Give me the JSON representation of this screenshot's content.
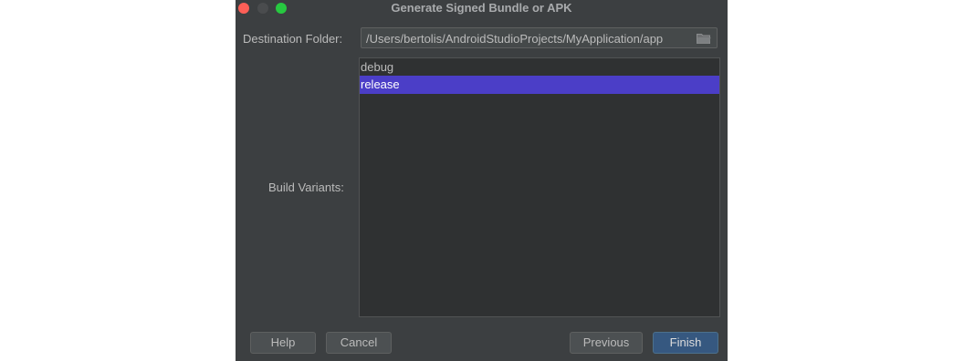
{
  "dialog": {
    "title": "Generate Signed Bundle or APK"
  },
  "destination": {
    "label": "Destination Folder:",
    "value": "/Users/bertolis/AndroidStudioProjects/MyApplication/app"
  },
  "variants": {
    "label": "Build Variants:",
    "items": [
      {
        "label": "debug",
        "selected": false
      },
      {
        "label": "release",
        "selected": true
      }
    ]
  },
  "buttons": {
    "help": "Help",
    "cancel": "Cancel",
    "previous": "Previous",
    "finish": "Finish"
  },
  "colors": {
    "dialog_bg": "#3c3f41",
    "selection": "#4b3ec7",
    "default_button": "#365880",
    "close": "#fe5f57",
    "zoom": "#27c840"
  },
  "icons": {
    "folder": "folder-icon"
  }
}
